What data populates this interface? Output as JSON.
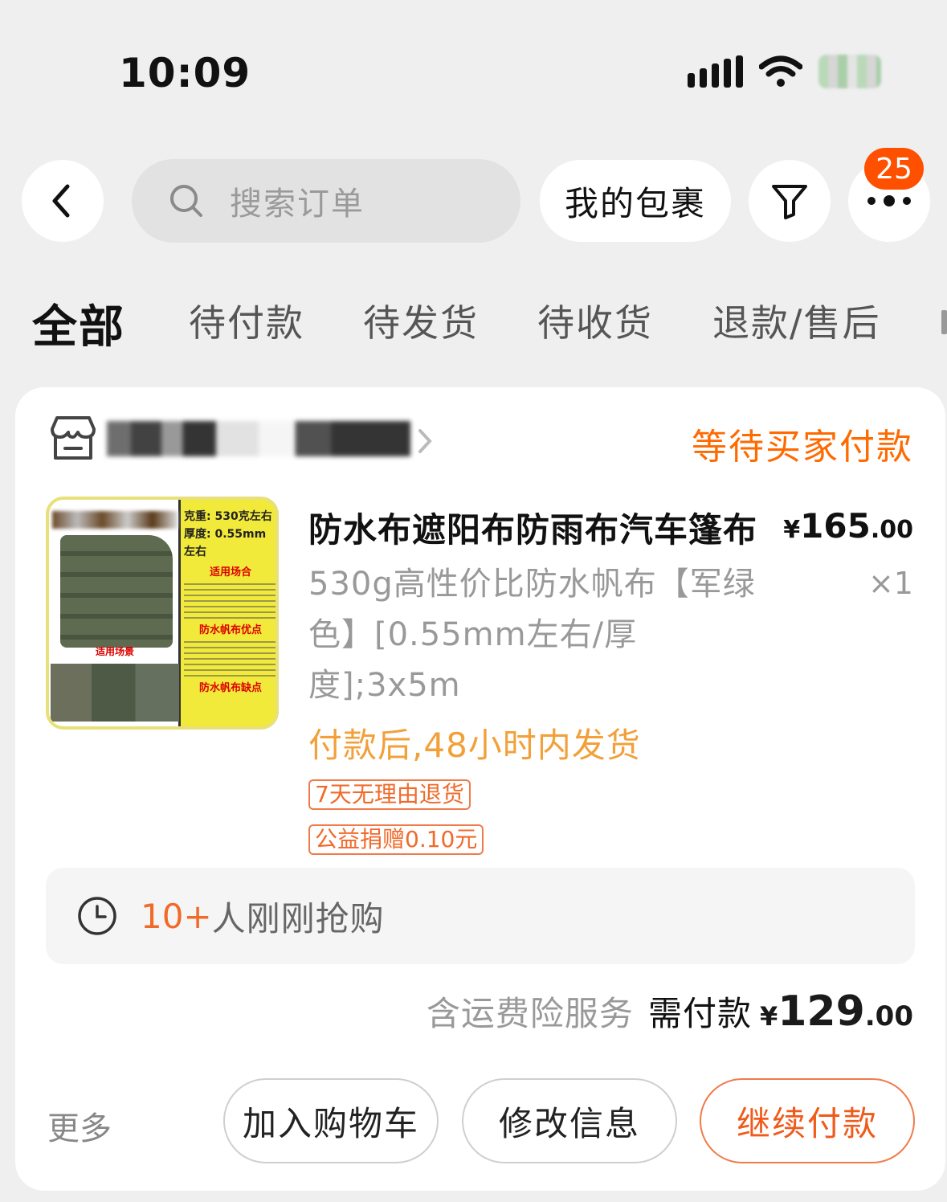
{
  "status_bar": {
    "time": "10:09"
  },
  "header": {
    "search_placeholder": "搜索订单",
    "packages_label": "我的包裹",
    "more_badge": "25"
  },
  "tabs": [
    {
      "label": "全部",
      "active": true
    },
    {
      "label": "待付款"
    },
    {
      "label": "待发货"
    },
    {
      "label": "待收货"
    },
    {
      "label": "退款/售后"
    }
  ],
  "order": {
    "status": "等待买家付款",
    "product": {
      "title": "防水布遮阳布防雨布汽车篷布",
      "price_symbol": "¥",
      "price_int": "165",
      "price_dec": ".00",
      "sku": "530g高性价比防水帆布【军绿色】[0.55mm左右/厚度];3x5m",
      "quantity": "×1",
      "shipping_note": "付款后,48小时内发货",
      "tags": [
        "7天无理由退货",
        "公益捐赠0.10元"
      ],
      "thumbnail": {
        "weight": "克重: 530克左右",
        "thickness": "厚度: 0.55mm左右",
        "usage_title": "适用场合",
        "pros_title": "防水帆布优点",
        "cons_title": "防水帆布缺点",
        "scene_label": "适用场景"
      }
    },
    "hot": {
      "count": "10+",
      "text": "人刚刚抢购"
    },
    "total": {
      "service": "含运费险服务",
      "need_pay": "需付款",
      "symbol": "¥",
      "int": "129",
      "dec": ".00"
    },
    "actions": {
      "more": "更多",
      "add_cart": "加入购物车",
      "edit_info": "修改信息",
      "continue_pay": "继续付款"
    }
  },
  "colors": {
    "accent": "#ff5000",
    "status_orange": "#ff6a00",
    "ship_note": "#f2a03a"
  }
}
